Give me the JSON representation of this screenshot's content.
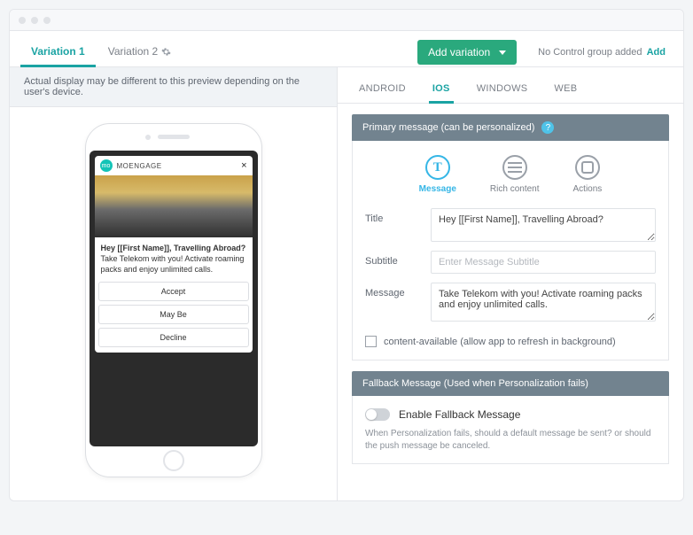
{
  "tabs": {
    "var1": "Variation 1",
    "var2": "Variation 2"
  },
  "add_variation": "Add variation",
  "control_group": {
    "text": "No Control group added",
    "add": "Add"
  },
  "notice": "Actual display may be different to this preview depending on the user's device.",
  "preview": {
    "brand": "MOENGAGE",
    "title": "Hey [[First Name]], Travelling Abroad?",
    "body": "Take Telekom with you! Activate roaming packs and enjoy unlimited calls.",
    "buttons": [
      "Accept",
      "May Be",
      "Decline"
    ]
  },
  "platforms": [
    "ANDROID",
    "IOS",
    "WINDOWS",
    "WEB"
  ],
  "primary_section": {
    "title": "Primary message (can be personalized)",
    "types": {
      "message": "Message",
      "rich": "Rich content",
      "actions": "Actions"
    },
    "fields": {
      "title_label": "Title",
      "title_value": "Hey [[First Name]], Travelling Abroad?",
      "subtitle_label": "Subtitle",
      "subtitle_placeholder": "Enter Message Subtitle",
      "message_label": "Message",
      "message_value": "Take Telekom with you! Activate roaming packs and enjoy unlimited calls."
    },
    "content_available": "content-available (allow app to refresh in background)"
  },
  "fallback_section": {
    "title": "Fallback Message (Used when Personalization fails)",
    "enable": "Enable Fallback Message",
    "note": "When Personalization fails, should a default message be sent? or should the push message be canceled."
  }
}
